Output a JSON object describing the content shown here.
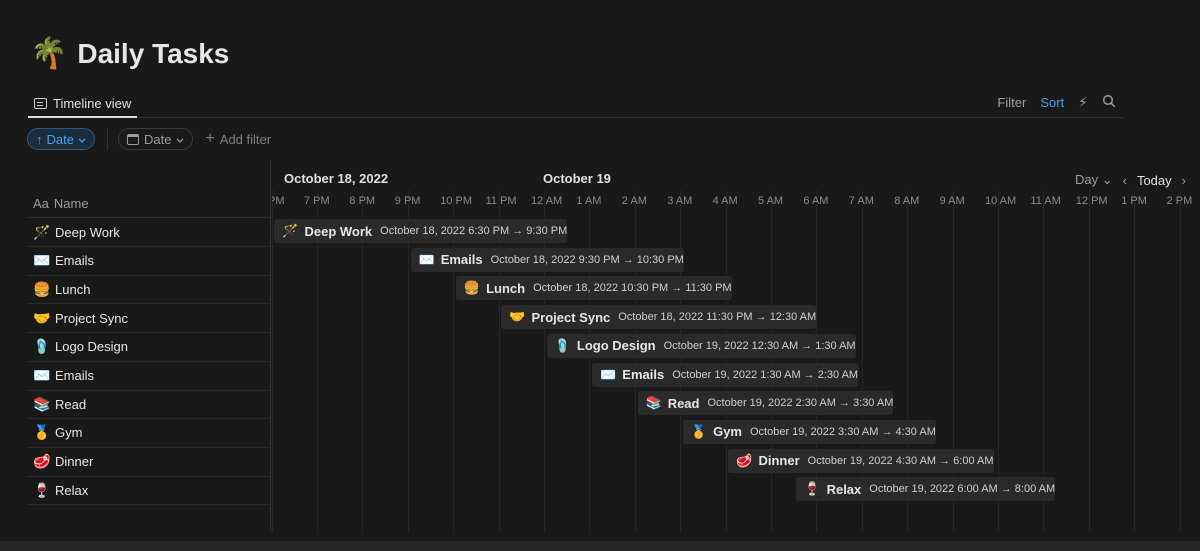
{
  "page": {
    "emoji": "🌴",
    "title": "Daily Tasks"
  },
  "view_tab": {
    "label": "Timeline view"
  },
  "actions": {
    "filter": "Filter",
    "sort": "Sort",
    "automation_icon": "lightning-icon",
    "search_icon": "search-icon"
  },
  "filters": {
    "sort_chip": "Date",
    "date_chip": "Date",
    "add_filter": "Add filter"
  },
  "timeline": {
    "name_header_prefix": "Aa",
    "name_header": "Name",
    "dates": [
      "October 18, 2022",
      "October 19"
    ],
    "hours": [
      "PM",
      "7 PM",
      "8 PM",
      "9 PM",
      "10 PM",
      "11 PM",
      "12 AM",
      "1 AM",
      "2 AM",
      "3 AM",
      "4 AM",
      "5 AM",
      "6 AM",
      "7 AM",
      "8 AM",
      "9 AM",
      "10 AM",
      "11 AM",
      "12 PM",
      "1 PM",
      "2 PM"
    ],
    "zoom": "Day",
    "today": "Today"
  },
  "tasks": [
    {
      "emoji": "🪄",
      "name": "Deep Work",
      "range": "October 18, 2022 6:30 PM → 9:30 PM"
    },
    {
      "emoji": "✉️",
      "name": "Emails",
      "range": "October 18, 2022 9:30 PM → 10:30 PM"
    },
    {
      "emoji": "🍔",
      "name": "Lunch",
      "range": "October 18, 2022 10:30 PM → 11:30 PM"
    },
    {
      "emoji": "🤝",
      "name": "Project Sync",
      "range": "October 18, 2022 11:30 PM → 12:30 AM"
    },
    {
      "emoji": "🩴",
      "name": "Logo Design",
      "range": "October 19, 2022 12:30 AM → 1:30 AM"
    },
    {
      "emoji": "✉️",
      "name": "Emails",
      "range": "October 19, 2022 1:30 AM → 2:30 AM"
    },
    {
      "emoji": "📚",
      "name": "Read",
      "range": "October 19, 2022 2:30 AM → 3:30 AM"
    },
    {
      "emoji": "🥇",
      "name": "Gym",
      "range": "October 19, 2022 3:30 AM → 4:30 AM"
    },
    {
      "emoji": "🥩",
      "name": "Dinner",
      "range": "October 19, 2022 4:30 AM → 6:00 AM"
    },
    {
      "emoji": "🍷",
      "name": "Relax",
      "range": "October 19, 2022 6:00 AM → 8:00 AM"
    }
  ],
  "task_schedule_hours_from_6pm": [
    [
      0.5,
      3.5
    ],
    [
      3.5,
      4.5
    ],
    [
      4.5,
      5.5
    ],
    [
      5.5,
      6.5
    ],
    [
      6.5,
      7.5
    ],
    [
      7.5,
      8.5
    ],
    [
      8.5,
      9.5
    ],
    [
      9.5,
      10.5
    ],
    [
      10.5,
      12.0
    ],
    [
      12.0,
      14.0
    ]
  ]
}
